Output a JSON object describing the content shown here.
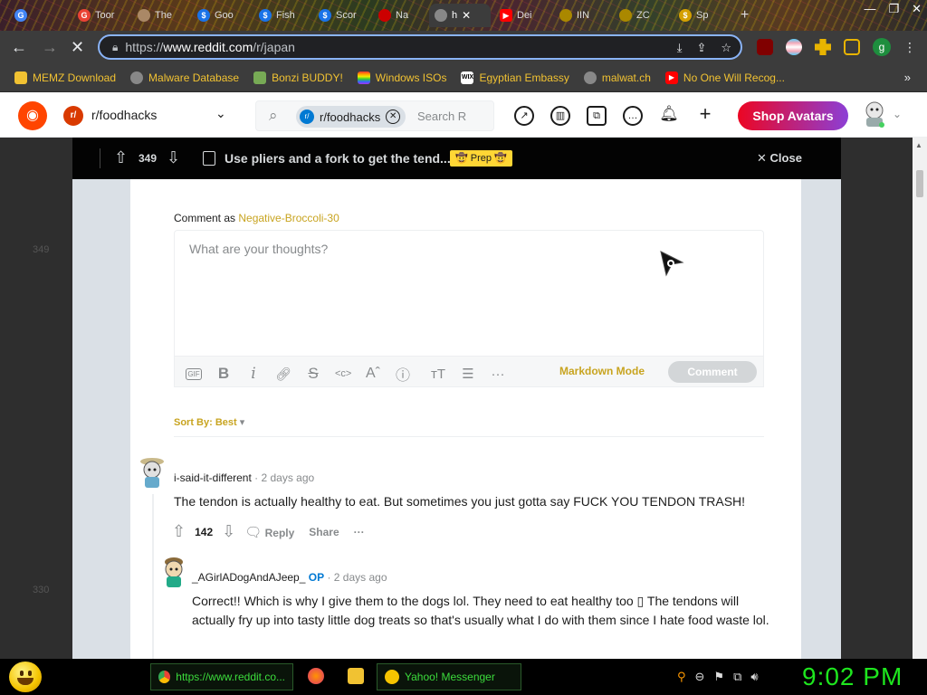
{
  "browser": {
    "tabs": [
      {
        "label": "",
        "icon": "google-icon",
        "color": "#4285f4"
      },
      {
        "label": "Toor",
        "icon": "google-icon",
        "color": "#ea4335"
      },
      {
        "label": "The",
        "icon": "chrome-icon",
        "color": "#a86"
      },
      {
        "label": "Goo",
        "icon": "dollar-icon",
        "color": "#1a73e8"
      },
      {
        "label": "Fish",
        "icon": "dollar-icon",
        "color": "#1a73e8"
      },
      {
        "label": "Scor",
        "icon": "dollar-icon",
        "color": "#1a73e8"
      },
      {
        "label": "Na",
        "icon": "flag-icon",
        "color": "#c00"
      },
      {
        "label": "h",
        "icon": "page-icon",
        "color": "#888",
        "active": true
      },
      {
        "label": "Dei",
        "icon": "youtube-icon",
        "color": "#ff0000"
      },
      {
        "label": "IIN",
        "icon": "page-icon",
        "color": "#aa8800"
      },
      {
        "label": "ZC",
        "icon": "page-icon",
        "color": "#aa8800"
      },
      {
        "label": "Sp",
        "icon": "dollar-icon",
        "color": "#d4a000"
      }
    ],
    "url_prefix": "https://",
    "url_domain": "www.reddit.com",
    "url_path": "/r/japan",
    "profile_initial": "g",
    "bookmarks": [
      {
        "label": "MEMZ Download",
        "icon": "page-icon",
        "color": "#f1c232"
      },
      {
        "label": "Malware Database",
        "icon": "globe-icon",
        "color": "#888"
      },
      {
        "label": "Bonzi BUDDY!",
        "icon": "bonzi-icon",
        "color": "#7a5"
      },
      {
        "label": "Windows ISOs",
        "icon": "rainbow-icon",
        "color": "#e33"
      },
      {
        "label": "Egyptian Embassy",
        "icon": "wix-icon",
        "color": "#fff"
      },
      {
        "label": "malwat.ch",
        "icon": "globe-icon",
        "color": "#888"
      },
      {
        "label": "No One Will Recog...",
        "icon": "youtube-icon",
        "color": "#ff0000"
      }
    ],
    "bookmarks_more": "»"
  },
  "reddit_header": {
    "subreddit": "r/foodhacks",
    "search_chip": "r/foodhacks",
    "search_placeholder": "Search R",
    "shop_label": "Shop Avatars"
  },
  "post_bar": {
    "score": "349",
    "title": "Use pliers and a fork to get the tend...",
    "flair": "🤠 Prep 🤠",
    "close_label": "Close"
  },
  "comment_box": {
    "prefix": "Comment as ",
    "username": "Negative-Broccoli-30",
    "placeholder": "What are your thoughts?",
    "markdown_label": "Markdown Mode",
    "submit_label": "Comment"
  },
  "sort_label": "Sort By: Best",
  "comments": [
    {
      "author": "i-said-it-different",
      "op": "",
      "time": "· 2 days ago",
      "body": "The tendon is actually healthy to eat. But sometimes you just gotta say FUCK YOU TENDON TRASH!",
      "score": "142",
      "reply": "Reply",
      "share": "Share"
    },
    {
      "author": "_AGirlADogAndAJeep_",
      "op": "OP",
      "time": "· 2 days ago",
      "body": "Correct!! Which is why I give them to the dogs lol. They need to eat healthy too ▯ The tendons will actually fry up into tasty little dog treats so that's usually what I do with them since I hate food waste lol."
    }
  ],
  "background_ghost": [
    "349",
    "330"
  ],
  "taskbar": {
    "chrome_label": "https://www.reddit.co...",
    "yahoo_label": "Yahoo! Messenger",
    "clock": "9:02 PM"
  }
}
